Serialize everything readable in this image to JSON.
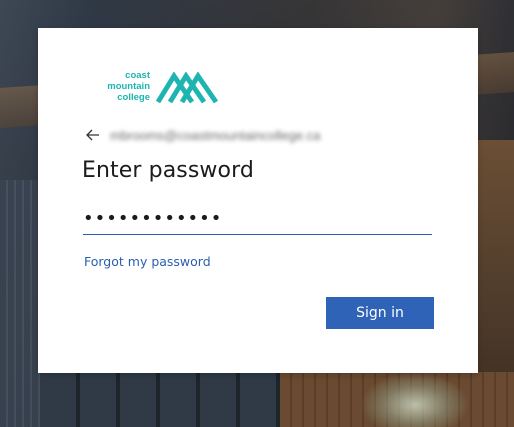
{
  "brand": {
    "logo_lines": [
      "coast",
      "mountain",
      "college"
    ],
    "logo_color": "#1eb5b0",
    "logo_icon": "mountain-chevrons-icon"
  },
  "identity": {
    "back_icon": "back-arrow-icon",
    "email": "mbrooms@coastmountaincollege.ca"
  },
  "form": {
    "title": "Enter password",
    "password_value": "••••••••••••",
    "forgot_link": "Forgot my password",
    "submit_label": "Sign in"
  },
  "colors": {
    "accent": "#2e63b8",
    "link": "#2a5fb0"
  }
}
